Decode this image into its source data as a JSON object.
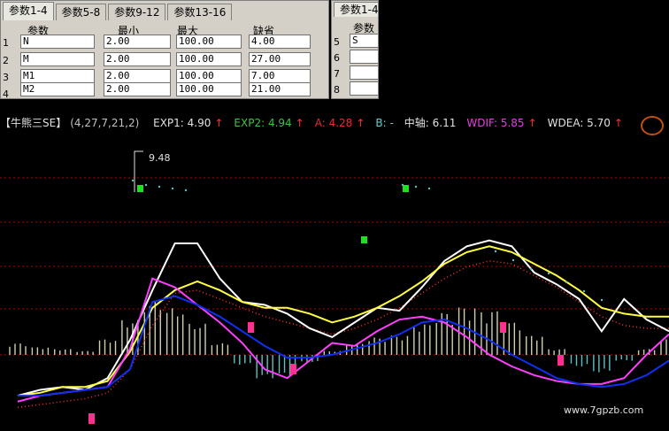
{
  "dialog": {
    "tabs": [
      "参数1-4",
      "参数5-8",
      "参数9-12",
      "参数13-16"
    ],
    "headers": [
      "参数",
      "最小",
      "最大",
      "缺省"
    ],
    "rows": [
      {
        "num": "1",
        "name": "N",
        "min": "2.00",
        "max": "100.00",
        "def": "4.00"
      },
      {
        "num": "2",
        "name": "M",
        "min": "2.00",
        "max": "100.00",
        "def": "27.00"
      },
      {
        "num": "3",
        "name": "M1",
        "min": "2.00",
        "max": "100.00",
        "def": "7.00"
      },
      {
        "num": "4",
        "name": "M2",
        "min": "2.00",
        "max": "100.00",
        "def": "21.00"
      }
    ]
  },
  "dialog2": {
    "tab": "参数1-4",
    "header": "参数",
    "rows": [
      {
        "num": "5",
        "name": "S"
      },
      {
        "num": "6",
        "name": ""
      },
      {
        "num": "7",
        "name": ""
      },
      {
        "num": "8",
        "name": ""
      }
    ]
  },
  "indicator_bar": {
    "name": "【牛熊三SE】",
    "params": "(4,27,7,21,2)",
    "items": [
      {
        "label": "EXP1: 4.90",
        "arrow": "↑",
        "color": "#e0e0e0"
      },
      {
        "label": "EXP2: 4.94",
        "arrow": "↑",
        "color": "#40c040"
      },
      {
        "label": "A: 4.28",
        "arrow": "↑",
        "color": "#e03030"
      },
      {
        "label": "B: -",
        "arrow": "",
        "color": "#60d0d0"
      },
      {
        "label": "中轴: 6.11",
        "arrow": "",
        "color": "#e0e0e0"
      },
      {
        "label": "WDIF: 5.85",
        "arrow": "↑",
        "color": "#e040e0"
      },
      {
        "label": "WDEA: 5.70",
        "arrow": "↑",
        "color": "#e0e0e0"
      }
    ],
    "arrow_color": "#ff3030"
  },
  "chart_data": {
    "type": "line",
    "annotations": [
      "9.48"
    ],
    "series": [
      {
        "color": "#ffffff",
        "values": [
          1.6,
          1.8,
          1.9,
          1.8,
          2.2,
          3.5,
          5.2,
          6.8,
          6.8,
          5.6,
          4.8,
          4.7,
          4.4,
          3.9,
          3.6,
          4.1,
          4.6,
          4.5,
          5.3,
          6.2,
          6.7,
          6.9,
          6.7,
          5.8,
          5.4,
          4.9,
          3.8,
          4.9,
          4.2,
          3.8
        ]
      },
      {
        "color": "#ffff40",
        "values": [
          1.6,
          1.7,
          1.9,
          1.9,
          2.1,
          3.1,
          4.6,
          5.2,
          5.5,
          5.2,
          4.8,
          4.6,
          4.6,
          4.4,
          4.1,
          4.3,
          4.6,
          5.0,
          5.5,
          6.1,
          6.5,
          6.7,
          6.5,
          6.1,
          5.7,
          5.2,
          4.6,
          4.4,
          4.3,
          4.3
        ]
      },
      {
        "color": "#ff40ff",
        "values": [
          1.4,
          1.6,
          1.7,
          1.8,
          1.9,
          3.2,
          5.6,
          5.3,
          4.7,
          4.1,
          3.4,
          2.5,
          2.2,
          2.8,
          3.4,
          3.3,
          3.8,
          4.2,
          4.3,
          4.1,
          3.6,
          3.0,
          2.6,
          2.3,
          2.1,
          2.0,
          2.0,
          2.2,
          3.0,
          3.7
        ]
      },
      {
        "color": "#1030f0",
        "values": [
          1.6,
          1.6,
          1.7,
          1.8,
          1.9,
          2.5,
          4.8,
          5.0,
          4.7,
          4.3,
          3.8,
          3.3,
          2.9,
          2.9,
          3.0,
          3.2,
          3.4,
          3.7,
          4.1,
          4.2,
          3.9,
          3.5,
          3.0,
          2.6,
          2.2,
          2.0,
          1.9,
          2.0,
          2.3,
          2.8
        ]
      }
    ],
    "red_dotted": [
      1.5,
      1.6,
      1.7,
      1.8,
      2.0,
      2.8,
      4.3,
      5.4,
      5.5,
      5.2,
      4.9,
      4.6,
      4.4,
      4.2,
      4.0,
      4.2,
      4.5,
      4.9,
      5.4,
      5.9,
      6.3,
      6.5,
      6.4,
      6.0,
      5.6,
      5.1,
      4.6,
      4.3,
      4.2,
      4.2
    ],
    "histogram": [
      0.6,
      0.4,
      0.3,
      0.2,
      0.8,
      1.8,
      2.8,
      2.4,
      1.6,
      0.6,
      -0.5,
      -1.2,
      -1.1,
      -0.4,
      0.2,
      0.6,
      0.9,
      1.0,
      1.6,
      2.2,
      2.5,
      2.3,
      1.7,
      1.0,
      0.3,
      -0.6,
      -0.9,
      -0.3,
      0.3,
      0.8
    ],
    "ylim": [
      1,
      10
    ]
  },
  "watermark": "www.7gpzb.com",
  "colors": {
    "dialog_bg": "#d4d0c8",
    "grid": "#b00000"
  }
}
